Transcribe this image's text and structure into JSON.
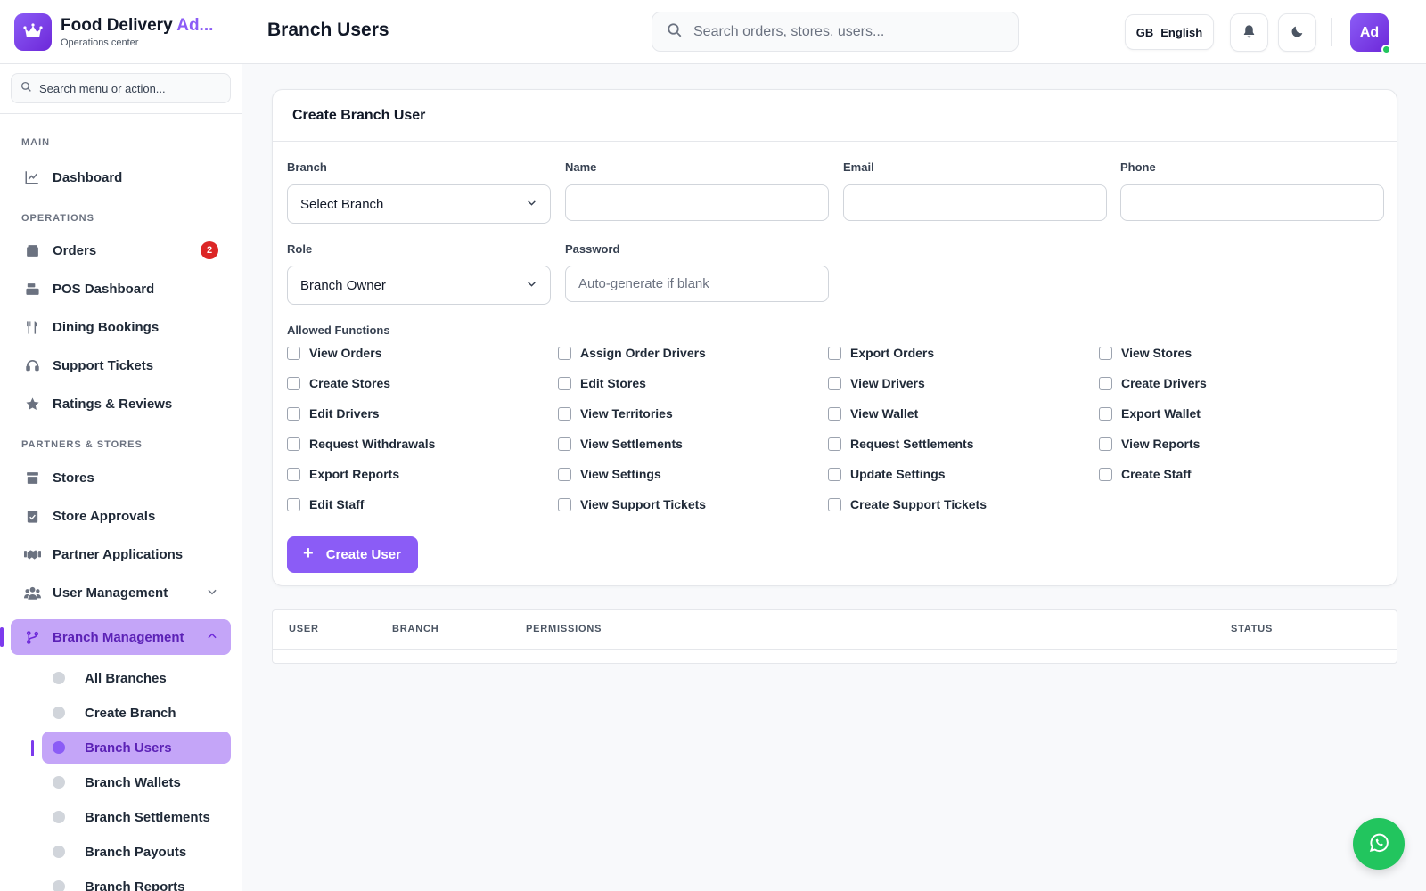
{
  "brand": {
    "title": "Food Delivery ",
    "title_accent": "Ad...",
    "subtitle": "Operations center"
  },
  "sidebar": {
    "search_placeholder": "Search menu or action...",
    "sections": {
      "main": "MAIN",
      "operations": "OPERATIONS",
      "partners": "PARTNERS & STORES"
    },
    "items": {
      "dashboard": "Dashboard",
      "orders": "Orders",
      "orders_badge": "2",
      "pos_dashboard": "POS Dashboard",
      "dining_bookings": "Dining Bookings",
      "support_tickets": "Support Tickets",
      "ratings_reviews": "Ratings & Reviews",
      "stores": "Stores",
      "store_approvals": "Store Approvals",
      "partner_applications": "Partner Applications",
      "user_management": "User Management",
      "branch_management": "Branch Management"
    },
    "branch_sub": [
      "All Branches",
      "Create Branch",
      "Branch Users",
      "Branch Wallets",
      "Branch Settlements",
      "Branch Payouts",
      "Branch Reports"
    ]
  },
  "header": {
    "page_title": "Branch Users",
    "search_placeholder": "Search orders, stores, users...",
    "lang_code": "GB",
    "lang_label": "English",
    "avatar_initials": "Ad"
  },
  "form": {
    "title": "Create Branch User",
    "labels": {
      "branch": "Branch",
      "name": "Name",
      "email": "Email",
      "phone": "Phone",
      "role": "Role",
      "password": "Password",
      "allowed_functions": "Allowed Functions"
    },
    "branch_value": "Select Branch",
    "name_value": "",
    "email_value": "",
    "phone_value": "",
    "role_value": "Branch Owner",
    "password_placeholder": "Auto-generate if blank",
    "functions": [
      [
        "View Orders",
        "Assign Order Drivers",
        "Export Orders",
        "View Stores"
      ],
      [
        "Create Stores",
        "Edit Stores",
        "View Drivers",
        "Create Drivers"
      ],
      [
        "Edit Drivers",
        "View Territories",
        "View Wallet",
        "Export Wallet"
      ],
      [
        "Request Withdrawals",
        "View Settlements",
        "Request Settlements",
        "View Reports"
      ],
      [
        "Export Reports",
        "View Settings",
        "Update Settings",
        "Create Staff"
      ],
      [
        "Edit Staff",
        "View Support Tickets",
        "Create Support Tickets"
      ]
    ],
    "submit_label": "Create User"
  },
  "table": {
    "columns": [
      "USER",
      "BRANCH",
      "PERMISSIONS",
      "STATUS"
    ]
  },
  "colors": {
    "accent": "#8b5cf6",
    "accent_active_bg": "#c4a5f8",
    "badge": "#dc2626",
    "whatsapp": "#22c55e"
  }
}
